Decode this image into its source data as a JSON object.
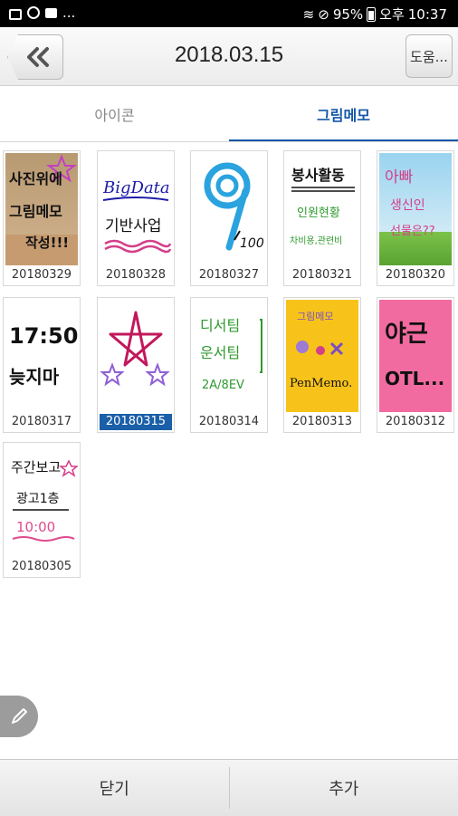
{
  "status_bar": {
    "battery": "95%",
    "ampm": "오후",
    "time": "10:37",
    "notification_dots": "..."
  },
  "header": {
    "title": "2018.03.15",
    "help_label": "도움..."
  },
  "tabs": [
    {
      "label": "아이콘",
      "active": false
    },
    {
      "label": "그림메모",
      "active": true
    }
  ],
  "memos": [
    {
      "date": "20180329",
      "thumb_text": [
        "사진위에",
        "그림메모",
        "작성!!!"
      ]
    },
    {
      "date": "20180328",
      "thumb_text": [
        "BigData",
        "기반사업"
      ]
    },
    {
      "date": "20180327",
      "thumb_text": [
        "9",
        "100"
      ]
    },
    {
      "date": "20180321",
      "thumb_text": [
        "봉사활동",
        "인원현황",
        "차비용,관련비"
      ]
    },
    {
      "date": "20180320",
      "thumb_text": [
        "아빠",
        "생신인",
        "선물은??"
      ]
    },
    {
      "date": "20180317",
      "thumb_text": [
        "17:50",
        "늦지마"
      ]
    },
    {
      "date": "20180315",
      "thumb_text": [],
      "selected": true
    },
    {
      "date": "20180314",
      "thumb_text": [
        "디서팀",
        "운서팀",
        "2A/8EV"
      ]
    },
    {
      "date": "20180313",
      "thumb_text": [
        "그림메모",
        "PenMemo."
      ]
    },
    {
      "date": "20180312",
      "thumb_text": [
        "야근",
        "OTL..."
      ]
    },
    {
      "date": "20180305",
      "thumb_text": [
        "주간보고",
        "광고1층",
        "10:00"
      ]
    }
  ],
  "bottom": {
    "close_label": "닫기",
    "add_label": "추가"
  },
  "colors": {
    "accent": "#1457a8",
    "selected_date_bg": "#1a5fa8"
  }
}
